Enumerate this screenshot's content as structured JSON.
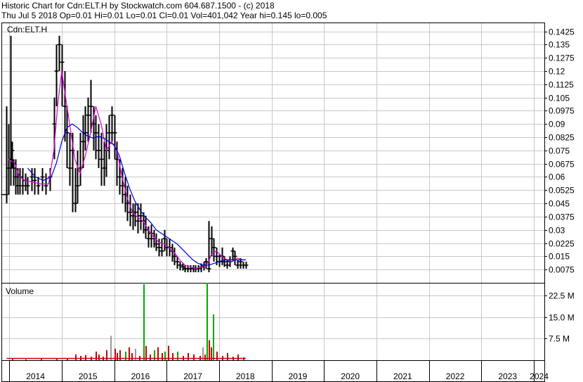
{
  "header": {
    "line1": "Historic Chart for Cdn:ELT.H by Stockwatch.com 604.687.1500 - (c) 2018",
    "line2": "Thu Jul  5 2018   Op=0.01   Hi=0.01   Lo=0.01   Cl=0.01   Vol=401,042   Year hi=0.145   lo=0.005"
  },
  "chart_data": [
    {
      "type": "candlestick",
      "title": "Cdn:ELT.H",
      "ylim": [
        0.0,
        0.1475
      ],
      "yticks": [
        "0.1425",
        "0.135",
        "0.1275",
        "0.12",
        "0.1125",
        "0.105",
        "0.0975",
        "0.09",
        "0.0825",
        "0.075",
        "0.0675",
        "0.06",
        "0.0525",
        "0.045",
        "0.0375",
        "0.03",
        "0.0225",
        "0.015",
        "0.0075"
      ],
      "xlim": [
        2013.85,
        2024.2
      ],
      "xticks": [
        "2014",
        "2015",
        "2016",
        "2017",
        "2018",
        "2019",
        "2020",
        "2021",
        "2022",
        "2023",
        "2024"
      ],
      "grid": true,
      "series": [
        {
          "name": "",
          "color": "#000000",
          "x": [
            2013.88,
            2013.94,
            2013.98,
            2014.02,
            2014.05,
            2014.08,
            2014.12,
            2014.16,
            2014.2,
            2014.25,
            2014.3,
            2014.35,
            2014.42,
            2014.48,
            2014.55,
            2014.62,
            2014.7,
            2014.78,
            2014.85,
            2014.9,
            2014.95,
            2015.0,
            2015.05,
            2015.1,
            2015.15,
            2015.2,
            2015.25,
            2015.3,
            2015.35,
            2015.4,
            2015.45,
            2015.5,
            2015.55,
            2015.6,
            2015.65,
            2015.7,
            2015.75,
            2015.8,
            2015.85,
            2015.9,
            2015.95,
            2016.0,
            2016.05,
            2016.1,
            2016.15,
            2016.2,
            2016.25,
            2016.3,
            2016.35,
            2016.4,
            2016.45,
            2016.5,
            2016.55,
            2016.6,
            2016.65,
            2016.7,
            2016.75,
            2016.8,
            2016.85,
            2016.9,
            2016.95,
            2017.0,
            2017.05,
            2017.1,
            2017.15,
            2017.2,
            2017.25,
            2017.3,
            2017.35,
            2017.4,
            2017.45,
            2017.5,
            2017.55,
            2017.6,
            2017.65,
            2017.7,
            2017.75,
            2017.8,
            2017.85,
            2017.9,
            2017.95,
            2018.0,
            2018.05,
            2018.1,
            2018.15,
            2018.2,
            2018.25,
            2018.3,
            2018.35,
            2018.4,
            2018.45,
            2018.51
          ],
          "close": [
            0.05,
            0.05,
            0.065,
            0.07,
            0.075,
            0.065,
            0.06,
            0.055,
            0.06,
            0.055,
            0.058,
            0.055,
            0.06,
            0.058,
            0.055,
            0.06,
            0.055,
            0.06,
            0.09,
            0.12,
            0.135,
            0.125,
            0.1,
            0.085,
            0.065,
            0.075,
            0.045,
            0.055,
            0.065,
            0.08,
            0.085,
            0.095,
            0.1,
            0.09,
            0.085,
            0.075,
            0.07,
            0.065,
            0.075,
            0.085,
            0.095,
            0.085,
            0.07,
            0.06,
            0.055,
            0.05,
            0.045,
            0.04,
            0.038,
            0.04,
            0.035,
            0.038,
            0.035,
            0.03,
            0.025,
            0.028,
            0.025,
            0.022,
            0.02,
            0.018,
            0.025,
            0.02,
            0.02,
            0.018,
            0.015,
            0.012,
            0.01,
            0.009,
            0.008,
            0.008,
            0.008,
            0.008,
            0.008,
            0.008,
            0.009,
            0.01,
            0.012,
            0.008,
            0.025,
            0.02,
            0.015,
            0.012,
            0.015,
            0.012,
            0.01,
            0.012,
            0.018,
            0.015,
            0.01,
            0.012,
            0.01,
            0.01
          ],
          "low": [
            0.05,
            0.045,
            0.05,
            0.055,
            0.065,
            0.055,
            0.05,
            0.05,
            0.05,
            0.05,
            0.052,
            0.05,
            0.052,
            0.05,
            0.05,
            0.052,
            0.05,
            0.052,
            0.07,
            0.1,
            0.12,
            0.1,
            0.08,
            0.065,
            0.055,
            0.04,
            0.04,
            0.045,
            0.055,
            0.065,
            0.075,
            0.08,
            0.085,
            0.075,
            0.07,
            0.065,
            0.055,
            0.055,
            0.06,
            0.07,
            0.08,
            0.07,
            0.055,
            0.05,
            0.045,
            0.04,
            0.035,
            0.032,
            0.03,
            0.032,
            0.028,
            0.03,
            0.028,
            0.025,
            0.02,
            0.02,
            0.02,
            0.018,
            0.015,
            0.015,
            0.018,
            0.015,
            0.015,
            0.012,
            0.01,
            0.008,
            0.007,
            0.007,
            0.006,
            0.006,
            0.006,
            0.006,
            0.006,
            0.006,
            0.006,
            0.007,
            0.008,
            0.006,
            0.015,
            0.012,
            0.01,
            0.009,
            0.01,
            0.009,
            0.008,
            0.009,
            0.012,
            0.01,
            0.008,
            0.008,
            0.008,
            0.008
          ],
          "high": [
            0.05,
            0.1,
            0.09,
            0.14,
            0.08,
            0.07,
            0.07,
            0.065,
            0.065,
            0.065,
            0.062,
            0.06,
            0.065,
            0.065,
            0.06,
            0.065,
            0.062,
            0.065,
            0.105,
            0.135,
            0.14,
            0.135,
            0.12,
            0.1,
            0.085,
            0.085,
            0.065,
            0.075,
            0.085,
            0.095,
            0.1,
            0.105,
            0.115,
            0.1,
            0.095,
            0.09,
            0.085,
            0.08,
            0.09,
            0.095,
            0.1,
            0.095,
            0.08,
            0.07,
            0.065,
            0.06,
            0.055,
            0.05,
            0.045,
            0.045,
            0.045,
            0.045,
            0.04,
            0.038,
            0.032,
            0.033,
            0.03,
            0.028,
            0.025,
            0.025,
            0.03,
            0.025,
            0.025,
            0.022,
            0.02,
            0.015,
            0.012,
            0.011,
            0.01,
            0.01,
            0.01,
            0.01,
            0.01,
            0.01,
            0.011,
            0.012,
            0.014,
            0.035,
            0.032,
            0.025,
            0.02,
            0.016,
            0.02,
            0.015,
            0.013,
            0.015,
            0.02,
            0.018,
            0.013,
            0.014,
            0.012,
            0.012
          ]
        },
        {
          "name": "",
          "color": "#dd00dd",
          "x": [
            2013.98,
            2014.1,
            2014.2,
            2014.3,
            2014.45,
            2014.6,
            2014.75,
            2014.85,
            2014.92,
            2015.0,
            2015.05,
            2015.15,
            2015.25,
            2015.35,
            2015.45,
            2015.55,
            2015.65,
            2015.75,
            2015.85,
            2015.95,
            2016.05,
            2016.15,
            2016.25,
            2016.35,
            2016.45,
            2016.55,
            2016.65,
            2016.75,
            2016.85,
            2016.95,
            2017.05,
            2017.15,
            2017.25,
            2017.35,
            2017.45,
            2017.55,
            2017.65,
            2017.75,
            2017.8,
            2017.85,
            2017.95,
            2018.05,
            2018.15,
            2018.25,
            2018.35,
            2018.45,
            2018.51
          ],
          "y": [
            0.07,
            0.068,
            0.06,
            0.058,
            0.057,
            0.056,
            0.056,
            0.075,
            0.1,
            0.12,
            0.11,
            0.09,
            0.07,
            0.062,
            0.072,
            0.085,
            0.1,
            0.09,
            0.075,
            0.08,
            0.075,
            0.06,
            0.048,
            0.04,
            0.037,
            0.035,
            0.03,
            0.026,
            0.023,
            0.022,
            0.02,
            0.017,
            0.013,
            0.01,
            0.009,
            0.008,
            0.009,
            0.01,
            0.012,
            0.016,
            0.018,
            0.015,
            0.013,
            0.012,
            0.014,
            0.013,
            0.013
          ]
        },
        {
          "name": "",
          "color": "#0000cc",
          "x": [
            2014.35,
            2014.5,
            2014.65,
            2014.8,
            2014.9,
            2015.0,
            2015.1,
            2015.2,
            2015.3,
            2015.4,
            2015.5,
            2015.6,
            2015.7,
            2015.8,
            2015.9,
            2016.0,
            2016.1,
            2016.2,
            2016.3,
            2016.4,
            2016.5,
            2016.6,
            2016.7,
            2016.8,
            2016.9,
            2017.0,
            2017.1,
            2017.2,
            2017.3,
            2017.4,
            2017.5,
            2017.6,
            2017.7,
            2017.8,
            2017.9,
            2018.0,
            2018.1,
            2018.2,
            2018.3,
            2018.4,
            2018.51
          ],
          "y": [
            0.065,
            0.06,
            0.058,
            0.06,
            0.068,
            0.08,
            0.088,
            0.09,
            0.088,
            0.085,
            0.083,
            0.082,
            0.083,
            0.082,
            0.08,
            0.078,
            0.072,
            0.062,
            0.053,
            0.046,
            0.041,
            0.037,
            0.034,
            0.03,
            0.028,
            0.026,
            0.024,
            0.022,
            0.019,
            0.016,
            0.013,
            0.011,
            0.01,
            0.01,
            0.011,
            0.012,
            0.013,
            0.013,
            0.013,
            0.013,
            0.013
          ]
        }
      ]
    },
    {
      "type": "bar",
      "title": "Volume",
      "ylim": [
        0,
        27000000
      ],
      "yticks": [
        "22.5 M",
        "15.0 M",
        "7.5 M"
      ],
      "series": [
        {
          "name": "",
          "x": [
            2014.05,
            2014.3,
            2014.6,
            2014.9,
            2015.1,
            2015.25,
            2015.35,
            2015.45,
            2015.55,
            2015.65,
            2015.7,
            2015.78,
            2015.85,
            2015.92,
            2016.0,
            2016.05,
            2016.1,
            2016.2,
            2016.27,
            2016.33,
            2016.4,
            2016.47,
            2016.55,
            2016.6,
            2016.68,
            2016.75,
            2016.82,
            2016.9,
            2016.95,
            2017.02,
            2017.1,
            2017.2,
            2017.3,
            2017.4,
            2017.5,
            2017.62,
            2017.68,
            2017.72,
            2017.76,
            2017.8,
            2017.84,
            2017.88,
            2017.95,
            2018.05,
            2018.15,
            2018.25,
            2018.35,
            2018.45
          ],
          "values": [
            400000,
            300000,
            500000,
            400000,
            700000,
            2000000,
            1500000,
            1800000,
            1200000,
            3000000,
            2000000,
            1200000,
            3500000,
            8500000,
            4000000,
            2500000,
            3500000,
            3000000,
            4500000,
            2500000,
            4000000,
            1500000,
            26500000,
            5000000,
            2000000,
            3500000,
            4500000,
            2500000,
            3000000,
            5000000,
            2500000,
            3000000,
            1500000,
            2500000,
            2000000,
            1500000,
            4500000,
            2000000,
            27000000,
            7000000,
            4500000,
            16000000,
            3000000,
            1500000,
            2500000,
            1200000,
            2000000,
            1000000
          ],
          "colors": [
            "#cc0000",
            "#cc0000",
            "#cc0000",
            "#cc0000",
            "#cc0000",
            "#cc0000",
            "#cc0000",
            "#cc0000",
            "#cc0000",
            "#cc0000",
            "#cc0000",
            "#cc0000",
            "#cc0000",
            "#999999",
            "#cc0000",
            "#cc0000",
            "#cc0000",
            "#00aa00",
            "#cc0000",
            "#cc0000",
            "#999999",
            "#cc0000",
            "#00aa00",
            "#cc0000",
            "#cc0000",
            "#00aa00",
            "#cc0000",
            "#cc0000",
            "#00aa00",
            "#cc0000",
            "#cc0000",
            "#00aa00",
            "#cc0000",
            "#cc0000",
            "#cc0000",
            "#cc0000",
            "#999999",
            "#cc0000",
            "#00aa00",
            "#cc0000",
            "#cc0000",
            "#00aa00",
            "#cc0000",
            "#cc0000",
            "#cc0000",
            "#cc0000",
            "#cc0000",
            "#cc0000"
          ]
        }
      ]
    }
  ]
}
